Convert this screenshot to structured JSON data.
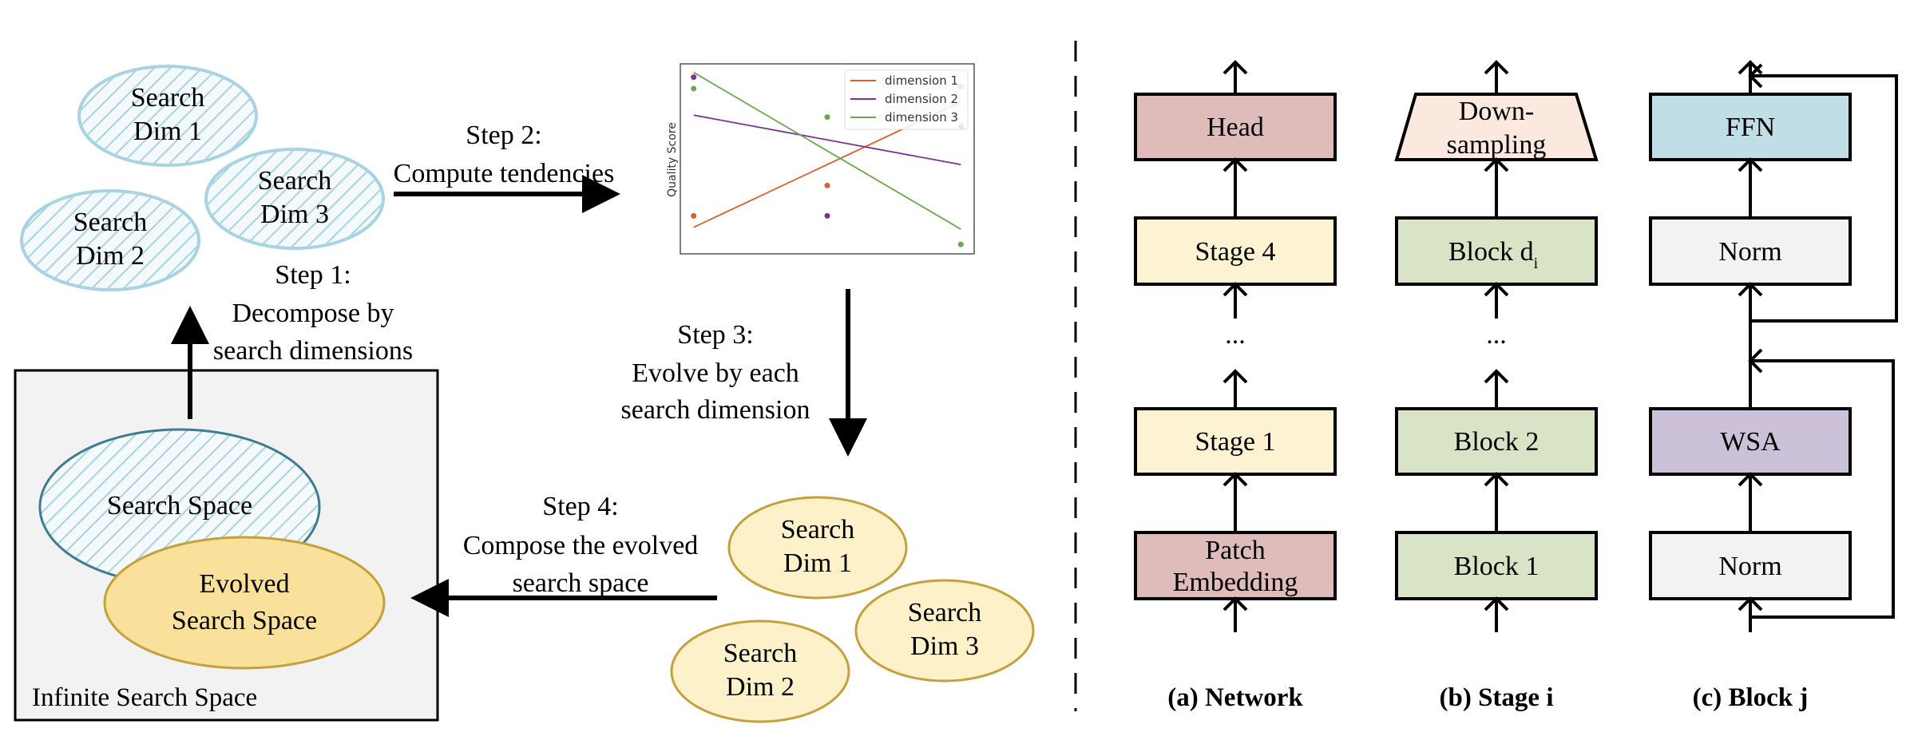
{
  "left_panel": {
    "initial_dims": [
      "Search Dim 1",
      "Search Dim 2",
      "Search Dim 3"
    ],
    "step1": [
      "Step 1:",
      "Decompose by",
      "search dimensions"
    ],
    "step2": [
      "Step 2:",
      "Compute tendencies"
    ],
    "step3": [
      "Step 3:",
      "Evolve by each",
      "search dimension"
    ],
    "step4": [
      "Step 4:",
      "Compose the evolved",
      "search space"
    ],
    "evolved_dims": [
      "Search Dim 1",
      "Search Dim 2",
      "Search Dim 3"
    ],
    "search_space": "Search Space",
    "evolved_space": [
      "Evolved",
      "Search Space"
    ],
    "infinite_space": "Infinite Search Space",
    "colors": {
      "hatch": "#a9d3e2",
      "search_space_stroke": "#3f7c92",
      "evolved_fill": "#f9e19c",
      "dim_fill": "#fdf1ca",
      "dim_stroke": "#c4a13c",
      "infinite_fill": "#f2f2f2"
    }
  },
  "chart_data": {
    "type": "line",
    "ylabel": "Quality Score",
    "xlabel": "",
    "xlim": [
      0.9,
      3.1
    ],
    "ylim": [
      0,
      1
    ],
    "legend_position": "top-right",
    "grid": false,
    "series": [
      {
        "name": "dimension 1",
        "color": "#d95f2b",
        "points_x": [
          1,
          2,
          3
        ],
        "points_y": [
          0.2,
          0.36,
          0.88
        ],
        "fit": [
          [
            1,
            0.14
          ],
          [
            3,
            0.8
          ]
        ]
      },
      {
        "name": "dimension 2",
        "color": "#7b3294",
        "points_x": [
          1,
          2,
          3
        ],
        "points_y": [
          0.93,
          0.2,
          0.67
        ],
        "fit": [
          [
            1,
            0.73
          ],
          [
            3,
            0.47
          ]
        ]
      },
      {
        "name": "dimension 3",
        "color": "#6aa84f",
        "points_x": [
          1,
          2,
          3
        ],
        "points_y": [
          0.87,
          0.72,
          0.05
        ],
        "fit": [
          [
            1,
            0.955
          ],
          [
            3,
            0.13
          ]
        ]
      }
    ]
  },
  "right_panel": {
    "network": {
      "boxes": [
        "Head",
        "Stage 4",
        "Stage 1"
      ],
      "patch": [
        "Patch",
        "Embedding"
      ],
      "dots": "...",
      "caption": "(a) Network"
    },
    "stage": {
      "down": [
        "Down-",
        "sampling"
      ],
      "block_d": "Block d",
      "block_d_sub": "i",
      "block2": "Block 2",
      "block1": "Block 1",
      "dots": "...",
      "caption": "(b) Stage i"
    },
    "block": {
      "ffn": "FFN",
      "norm_top": "Norm",
      "wsa": "WSA",
      "norm_bottom": "Norm",
      "caption": "(c) Block j"
    },
    "colors": {
      "head": "#dfbcba",
      "stage": "#fdf2d2",
      "block": "#d9e3c6",
      "down": "#fbe9df",
      "ffn": "#c1dde6",
      "norm": "#f2f2f2",
      "wsa": "#cbc2d9"
    }
  }
}
